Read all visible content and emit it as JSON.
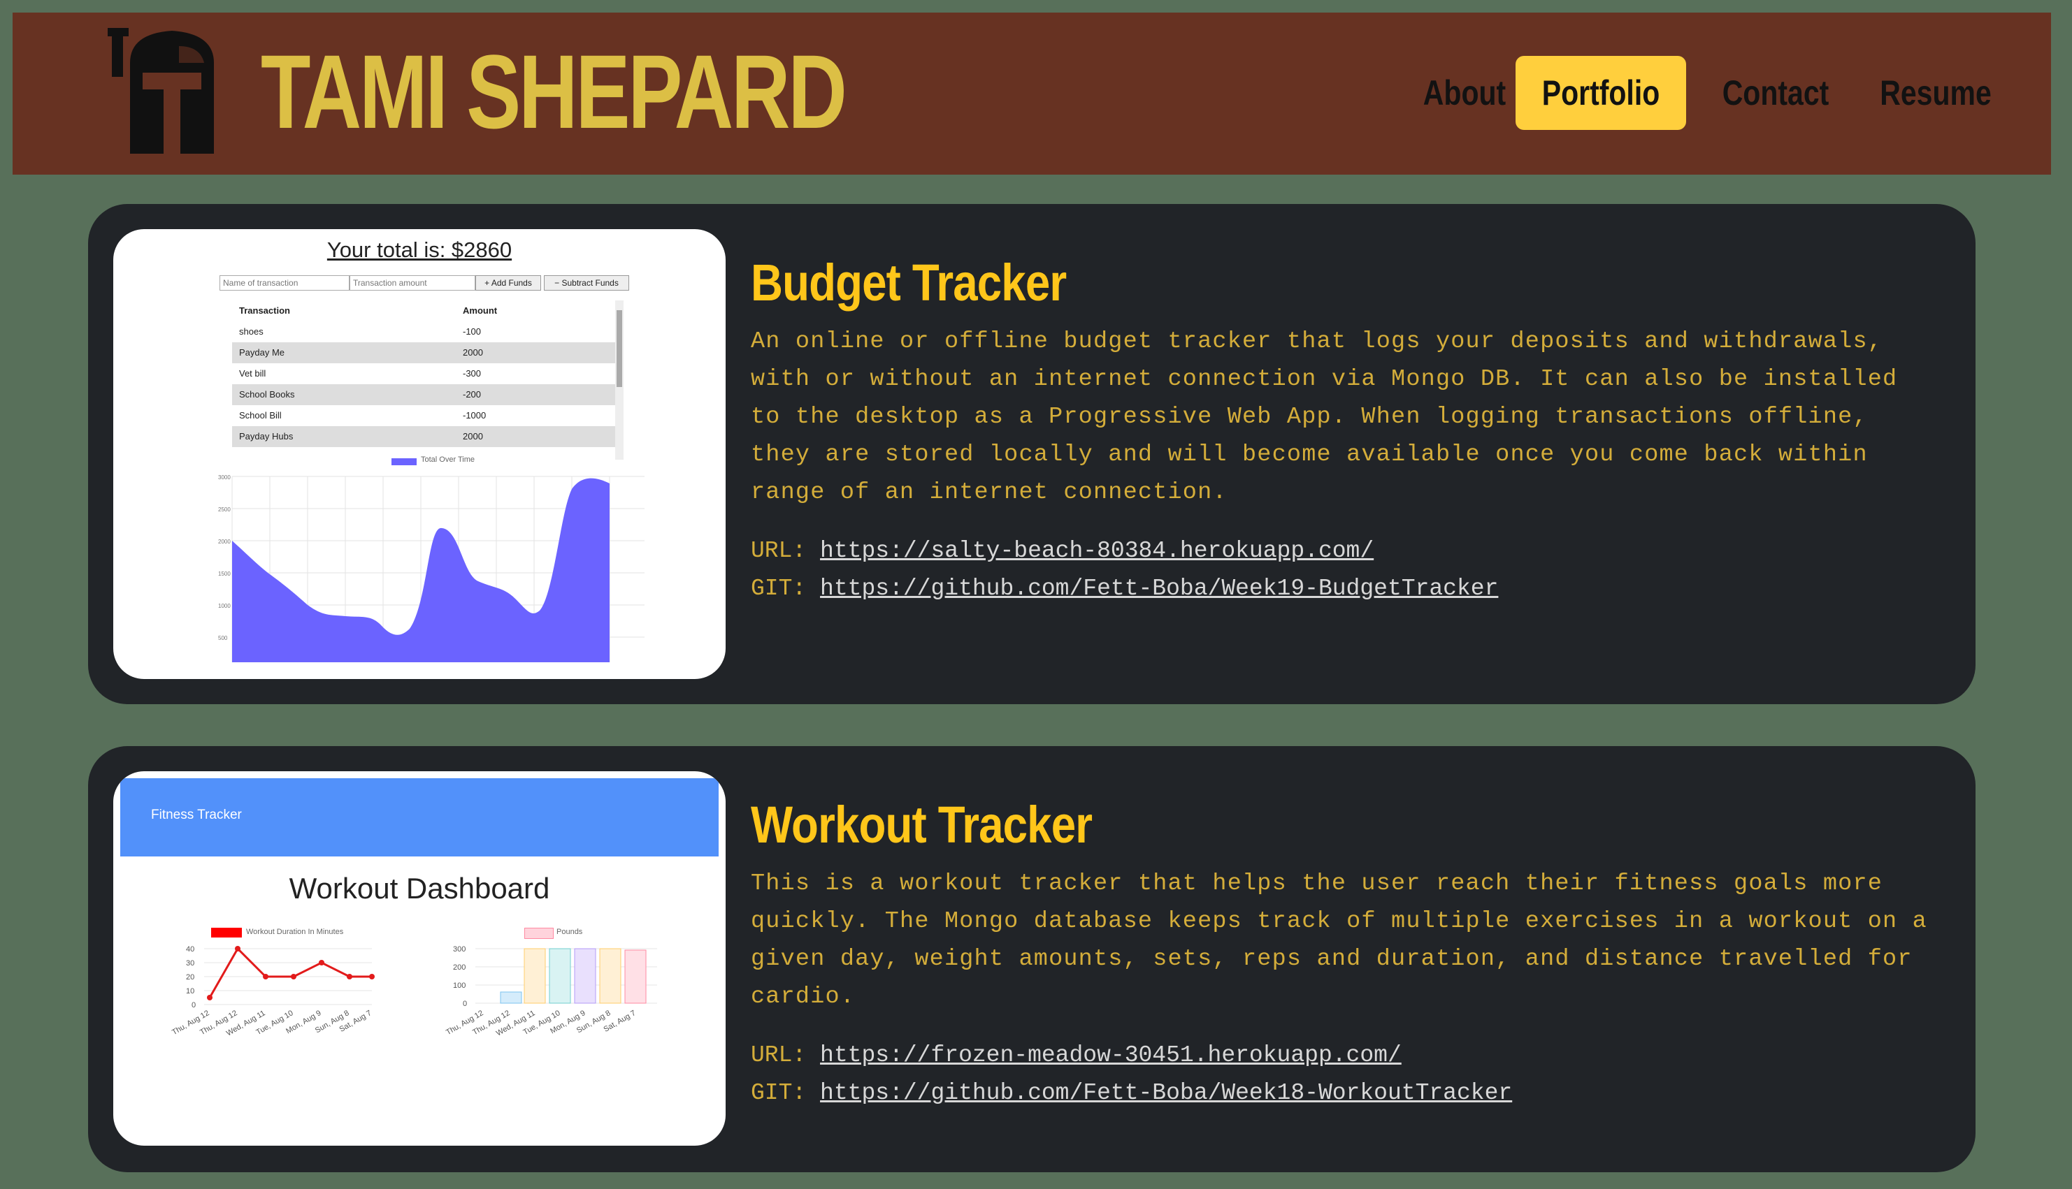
{
  "header": {
    "brand": "TAMI SHEPARD",
    "nav": [
      {
        "label": "About",
        "active": false
      },
      {
        "label": "Portfolio",
        "active": true
      },
      {
        "label": "Contact",
        "active": false
      },
      {
        "label": "Resume",
        "active": false
      }
    ],
    "colors": {
      "header_bg": "#673222",
      "brand": "#dcbf45",
      "active_nav": "#ffcf3d",
      "page_bg": "#58705a"
    }
  },
  "projects": [
    {
      "title": "Budget Tracker",
      "description": "An online or offline budget tracker that logs your deposits and withdrawals, with or without an internet connection via Mongo DB. It can also be installed to the desktop as a Progressive Web App. When logging transactions offline, they are stored locally and will become available once you come back within range of an internet connection.",
      "url_label": "URL:",
      "url": "https://salty-beach-80384.herokuapp.com/",
      "git_label": "GIT:",
      "git": "https://github.com/Fett-Boba/Week19-BudgetTracker",
      "screenshot": {
        "total": "Your total is: $2860",
        "name_placeholder": "Name of transaction",
        "amount_placeholder": "Transaction amount",
        "add_button": "+ Add Funds",
        "subtract_button": "− Subtract Funds",
        "table_headers": [
          "Transaction",
          "Amount"
        ],
        "rows": [
          [
            "shoes",
            "-100"
          ],
          [
            "Payday Me",
            "2000"
          ],
          [
            "Vet bill",
            "-300"
          ],
          [
            "School Books",
            "-200"
          ],
          [
            "School Bill",
            "-1000"
          ],
          [
            "Payday Hubs",
            "2000"
          ]
        ],
        "chart_legend": "Total Over Time"
      }
    },
    {
      "title": "Workout Tracker",
      "description": "This is a workout tracker that helps the user reach their fitness goals more quickly. The Mongo database keeps track of multiple exercises in a workout on a given day, weight amounts, sets, reps and duration, and distance travelled for cardio.",
      "url_label": "URL:",
      "url": "https://frozen-meadow-30451.herokuapp.com/",
      "git_label": "GIT:",
      "git": "https://github.com/Fett-Boba/Week18-WorkoutTracker",
      "screenshot": {
        "app_name": "Fitness Tracker",
        "dashboard_title": "Workout Dashboard",
        "legend_duration": "Workout Duration In Minutes",
        "legend_pounds": "Pounds",
        "days": [
          "Thu, Aug 12",
          "Thu, Aug 12",
          "Wed, Aug 11",
          "Tue, Aug 10",
          "Mon, Aug 9",
          "Sun, Aug 8",
          "Sat, Aug 7"
        ],
        "duration_values": [
          5,
          40,
          20,
          20,
          30,
          20,
          20
        ],
        "duration_ticks": [
          "40",
          "30",
          "20",
          "10",
          "0"
        ],
        "pounds_values": [
          0,
          60,
          300,
          300,
          300,
          300,
          290
        ],
        "pounds_ticks": [
          "300",
          "200",
          "100",
          "0"
        ]
      }
    }
  ]
}
